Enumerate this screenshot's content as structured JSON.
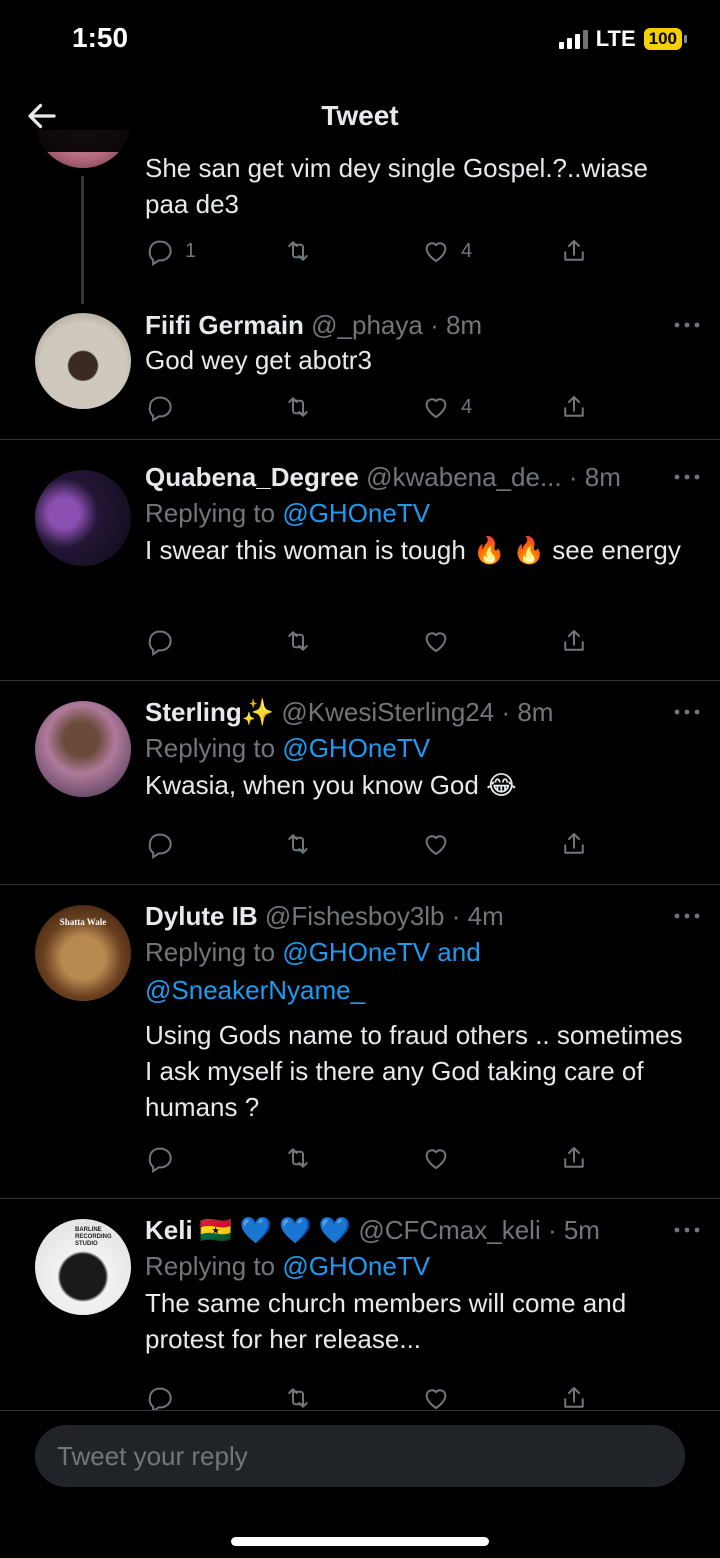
{
  "status": {
    "time": "1:50",
    "network": "LTE",
    "battery": "100"
  },
  "nav": {
    "title": "Tweet"
  },
  "tweets": [
    {
      "text": "She san get vim dey single Gospel.?..wiase paa de3",
      "replies": "1",
      "likes": "4"
    },
    {
      "name": "Fiifi Germain",
      "handle": "@_phaya",
      "time": "· 8m",
      "text": "God wey get abotr3",
      "likes": "4"
    },
    {
      "name": "Quabena_Degree",
      "handle": "@kwabena_de...",
      "time": "· 8m",
      "reply_prefix": "Replying to",
      "reply_mentions": "@GHOneTV",
      "text": "I swear this woman is tough 🔥 🔥 see energy"
    },
    {
      "name": "Sterling✨",
      "handle": "@KwesiSterling24",
      "time": "· 8m",
      "reply_prefix": "Replying to",
      "reply_mentions": "@GHOneTV",
      "text": "Kwasia, when you know God 😂"
    },
    {
      "name": "Dylute IB",
      "handle": "@Fishesboy3lb",
      "time": "· 4m",
      "reply_prefix": "Replying to",
      "reply_mentions": "@GHOneTV and @SneakerNyame_",
      "text": "Using Gods name to fraud others .. sometimes I ask myself is there any God taking care of humans ?"
    },
    {
      "name": "Keli 🇬🇭 💙 💙 💙",
      "handle": "@CFCmax_keli",
      "time": "· 5m",
      "reply_prefix": "Replying to",
      "reply_mentions": "@GHOneTV",
      "text": "The same church members will come and protest for her release..."
    }
  ],
  "avatar_labels": {
    "dylute": "Shatta Wale",
    "keli": "BARLINE RECORDING STUDIO"
  },
  "compose": {
    "placeholder": "Tweet your reply"
  },
  "colors": {
    "accent": "#1d9bf0",
    "muted": "#71767b",
    "background": "#000000",
    "battery": "#f5d000"
  }
}
